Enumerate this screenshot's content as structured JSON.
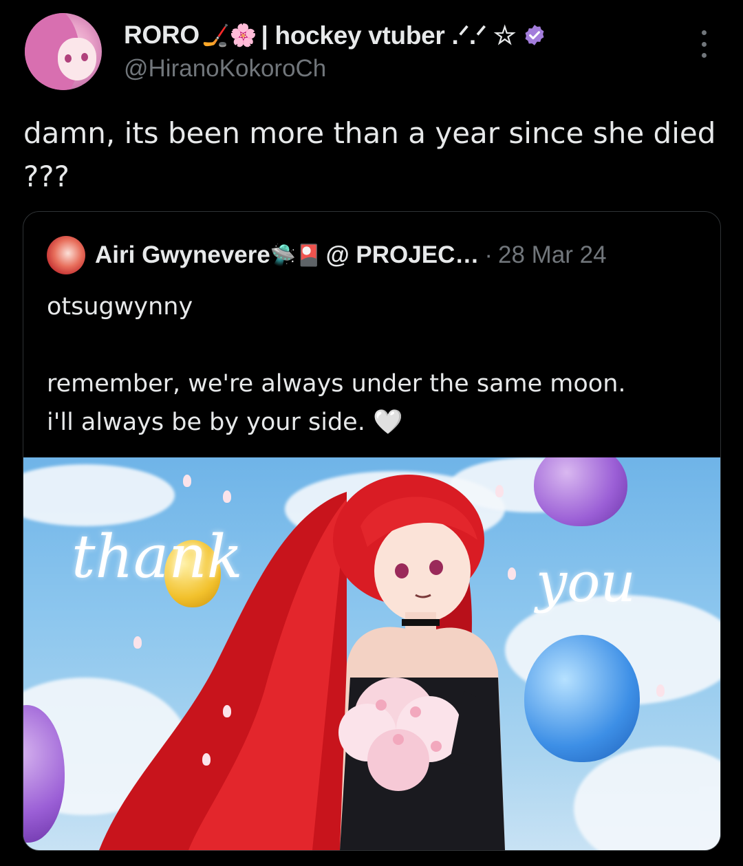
{
  "author": {
    "display_name": "RORO",
    "name_emoji": "🏒🌸",
    "name_suffix": "| hockey vtuber .ᐟ.ᐟ ☆",
    "handle": "@HiranoKokoroCh",
    "verified_color": "#a37ddb"
  },
  "tweet": {
    "text": "damn, its been more than a year since she died ???"
  },
  "quoted": {
    "display_name": "Airi Gwynevere",
    "name_emoji": "🛸🎴",
    "name_suffix": "@ PROJEC…",
    "date": "28 Mar 24",
    "text": "otsugwynny\n\nremember, we're always under the same moon.\ni'll always be by your side. 🤍",
    "image": {
      "script_left": "thank",
      "script_right": "you"
    }
  },
  "colors": {
    "background": "#000000",
    "text_primary": "#e7e9ea",
    "text_secondary": "#71767b",
    "border": "#2f3336"
  },
  "icons": {
    "more": "more-vertical-icon",
    "verified": "verified-badge-icon"
  }
}
